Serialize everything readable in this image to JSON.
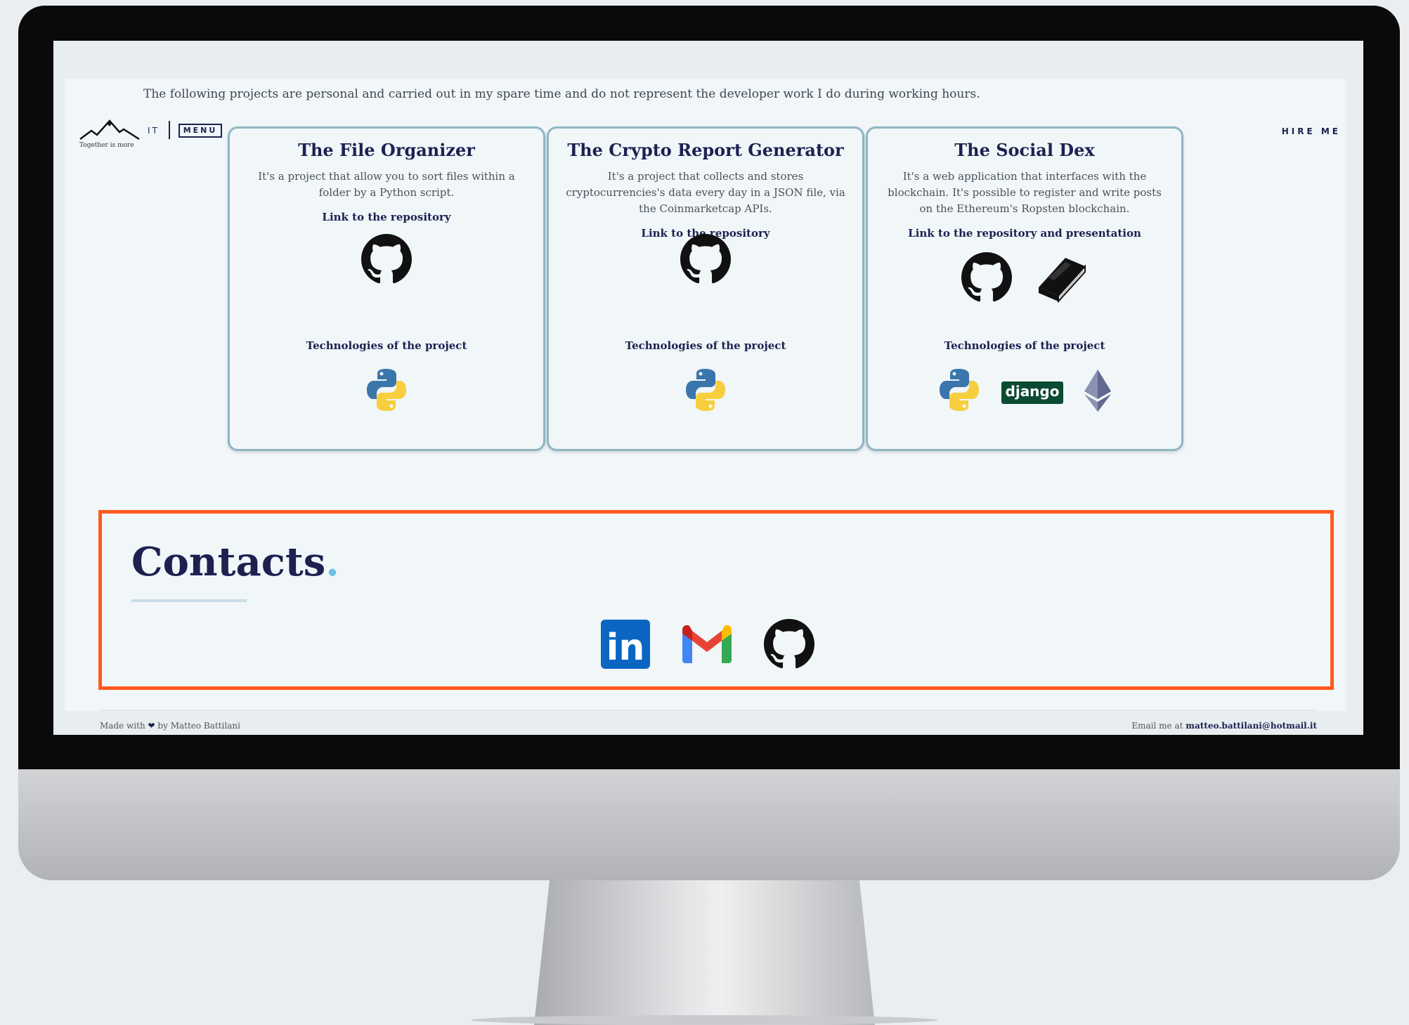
{
  "intro": "The following projects are personal and carried out in my spare time and do not represent the developer work I do during working hours.",
  "nav": {
    "logo_text": "Together is more",
    "lang": "IT",
    "menu": "MENU",
    "hire": "HIRE ME"
  },
  "cards": [
    {
      "title": "The File Organizer",
      "desc": "It's a project that allow you to sort files within a folder by a Python script.",
      "link": "Link to the repository",
      "tech_label": "Technologies of the project",
      "icons": [
        "github-icon"
      ],
      "tech": [
        "python-icon"
      ]
    },
    {
      "title": "The Crypto Report Generator",
      "desc": "It's a project that collects and stores cryptocurrencies's data every day in a JSON file, via the Coinmarketcap APIs.",
      "link": "Link to the repository",
      "tech_label": "Technologies of the project",
      "icons": [
        "github-icon"
      ],
      "tech": [
        "python-icon"
      ]
    },
    {
      "title": "The Social Dex",
      "desc": "It's a web application that interfaces with the blockchain. It's possible to register and write posts on the Ethereum's Ropsten blockchain.",
      "link": "Link to the repository and presentation",
      "tech_label": "Technologies of the project",
      "icons": [
        "github-icon",
        "book-icon"
      ],
      "tech": [
        "python-icon",
        "django-logo",
        "ethereum-icon"
      ],
      "django_text": "django"
    }
  ],
  "contacts": {
    "title": "Contacts",
    "dot": ".",
    "icons": [
      "linkedin-icon",
      "gmail-icon",
      "github-icon"
    ],
    "linkedin_text": "in"
  },
  "footer": {
    "made_with": "Made with",
    "by": "by Matteo Battilani",
    "email_prefix": "Email me at",
    "email": "matteo.battilani@hotmail.it"
  },
  "colors": {
    "accent": "#ff5a1f",
    "navy": "#1c2150",
    "card_border": "#8fb6c4"
  }
}
